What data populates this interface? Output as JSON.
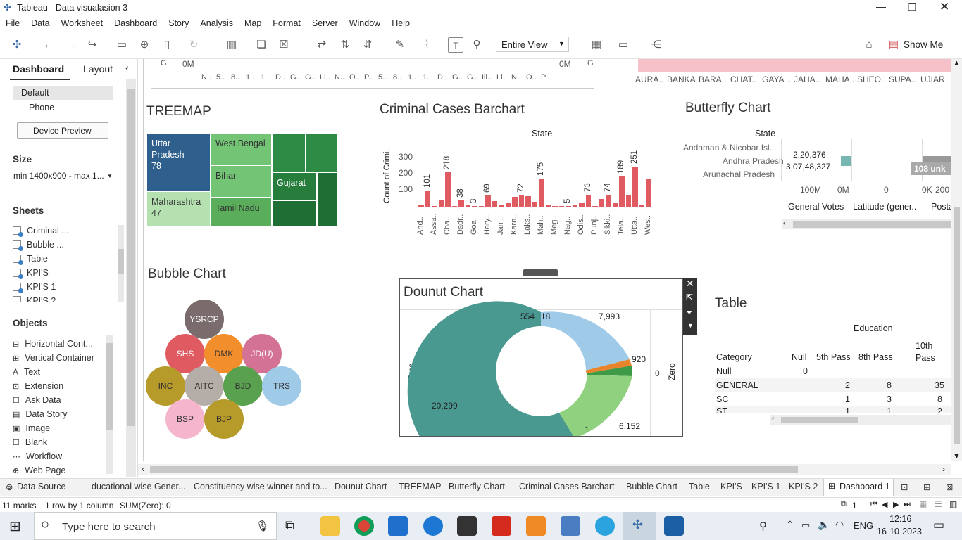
{
  "window": {
    "title": "Tableau - Data visualasion 3"
  },
  "menu": [
    "File",
    "Data",
    "Worksheet",
    "Dashboard",
    "Story",
    "Analysis",
    "Map",
    "Format",
    "Server",
    "Window",
    "Help"
  ],
  "toolbar": {
    "view_select": "Entire View",
    "show_me": "Show Me"
  },
  "left": {
    "tab_dashboard": "Dashboard",
    "tab_layout": "Layout",
    "device_default": "Default",
    "device_phone": "Phone",
    "device_preview": "Device Preview",
    "size_heading": "Size",
    "size_value": "min 1400x900 - max 1...",
    "sheets_heading": "Sheets",
    "sheets": [
      "Criminal ...",
      "Bubble ...",
      "Table",
      "KPI'S",
      "KPI'S 1",
      "KPI'S 2"
    ],
    "objects_heading": "Objects",
    "objects": [
      "Horizontal Cont...",
      "Vertical Container",
      "Text",
      "Extension",
      "Ask Data",
      "Data Story",
      "Image",
      "Blank",
      "Workflow",
      "Web Page"
    ]
  },
  "top_strip": {
    "axis_left": "G",
    "zero_left": "0M",
    "zero_mid": "0M",
    "axis_right": "G",
    "left_ticks": [
      "N..",
      "5..",
      "8..",
      "1..",
      "1..",
      "D..",
      "G..",
      "G..",
      "Li..",
      "N..",
      "O..",
      "P.."
    ],
    "mid_ticks": [
      "5..",
      "8..",
      "1..",
      "1..",
      "D..",
      "G..",
      "G..",
      "Ill..",
      "Li..",
      "N..",
      "O..",
      "P.."
    ],
    "right_ticks": [
      "AURA..",
      "BANKA",
      "BARA..",
      "CHAT..",
      "GAYA ..",
      "JAHA..",
      "MAHA..",
      "SHEO..",
      "SUPA..",
      "UJIAR"
    ]
  },
  "treemap": {
    "title": "TREEMAP",
    "cells": [
      {
        "label": "Uttar Pradesh",
        "value": "78"
      },
      {
        "label": "Maharashtra",
        "value": "47"
      },
      {
        "label": "West Bengal",
        "value": ""
      },
      {
        "label": "Bihar",
        "value": ""
      },
      {
        "label": "Tamil Nadu",
        "value": ""
      },
      {
        "label": "Gujarat",
        "value": ""
      }
    ]
  },
  "barchart": {
    "title": "Criminal Cases Barchart",
    "header": "State",
    "ylabel": "Count of Crimi..",
    "yticks": [
      "300",
      "200",
      "100"
    ],
    "colors": {
      "bar": "#e05a61"
    }
  },
  "chart_data": {
    "type": "bar",
    "title": "Criminal Cases Barchart",
    "xlabel": "State",
    "ylabel": "Count of Crimi..",
    "ylim": [
      0,
      300
    ],
    "categories": [
      "And..",
      "",
      "Assa..",
      "",
      "Cha..",
      "",
      "Dadr..",
      "",
      "Goa",
      "",
      "Hary..",
      "",
      "Jam..",
      "",
      "Karn..",
      "",
      "Laks..",
      "",
      "Mah..",
      "",
      "Meg..",
      "",
      "Nag..",
      "",
      "Odis..",
      "",
      "Punj..",
      "",
      "Sikki..",
      "",
      "Tela..",
      "",
      "Utta..",
      "Wes.."
    ],
    "values": [
      12,
      101,
      6,
      40,
      218,
      4,
      38,
      8,
      3,
      5,
      69,
      36,
      14,
      22,
      60,
      72,
      64,
      30,
      175,
      8,
      6,
      4,
      5,
      8,
      20,
      73,
      4,
      50,
      74,
      24,
      189,
      70,
      251,
      12,
      170
    ],
    "data_labels": {
      "1": "101",
      "4": "218",
      "6": "38",
      "8": "3",
      "10": "69",
      "15": "72",
      "18": "175",
      "22": "5",
      "25": "73",
      "28": "74",
      "30": "189",
      "32": "251"
    }
  },
  "butterfly": {
    "title": "Butterfly Chart",
    "header": "State",
    "rows": [
      {
        "state": "Andaman & Nicobar Isl..",
        "votes": ""
      },
      {
        "state": "Andhra Pradesh",
        "votes": "2,20,376"
      },
      {
        "state": "Arunachal Pradesh",
        "votes": "3,07,48,327"
      }
    ],
    "axis": [
      "100M",
      "0M",
      "0",
      "0K",
      "200"
    ],
    "cols": [
      "General Votes",
      "Latitude (gener..",
      "Posta"
    ],
    "badge": "108 unk"
  },
  "bubble": {
    "title": "Bubble Chart",
    "items": [
      {
        "label": "YSRCP",
        "color": "#7a6c6c"
      },
      {
        "label": "SHS",
        "color": "#e05a61"
      },
      {
        "label": "DMK",
        "color": "#f28e2b"
      },
      {
        "label": "JD(U)",
        "color": "#d37295"
      },
      {
        "label": "INC",
        "color": "#b69a2a"
      },
      {
        "label": "AITC",
        "color": "#b5ada8"
      },
      {
        "label": "BJD",
        "color": "#59a14f"
      },
      {
        "label": "TRS",
        "color": "#a0cbe8"
      },
      {
        "label": "BSP",
        "color": "#f5b5cc"
      },
      {
        "label": "BJP",
        "color": "#b69a2a"
      }
    ]
  },
  "donut": {
    "title": "Dounut Chart",
    "side_label": "Zero",
    "zero": "0",
    "labels": [
      "554",
      "18",
      "7,993",
      "920",
      "6,152",
      "1",
      "20,299"
    ]
  },
  "table": {
    "title": "Table",
    "super_header": "Education",
    "columns": [
      "Category",
      "Null",
      "5th Pass",
      "8th Pass",
      "10th Pass"
    ],
    "rows": [
      [
        "Null",
        "0",
        "",
        "",
        ""
      ],
      [
        "GENERAL",
        "",
        "2",
        "8",
        "35"
      ],
      [
        "SC",
        "",
        "1",
        "3",
        "8"
      ],
      [
        "ST",
        "",
        "1",
        "1",
        "2"
      ]
    ]
  },
  "tabs": [
    "Data Source",
    "ducational wise Gener...",
    "Constituency wise winner and to...",
    "Dounut Chart",
    "TREEMAP",
    "Butterfly Chart",
    "Criminal Cases Barchart",
    "Bubble Chart",
    "Table",
    "KPI'S",
    "KPI'S 1",
    "KPI'S 2",
    "Dashboard 1"
  ],
  "status": {
    "marks": "11 marks",
    "layout": "1 row by 1 column",
    "sum": "SUM(Zero): 0",
    "page": "1"
  },
  "taskbar": {
    "search": "Type here to search",
    "lang": "ENG",
    "time": "12:16",
    "date": "16-10-2023"
  }
}
